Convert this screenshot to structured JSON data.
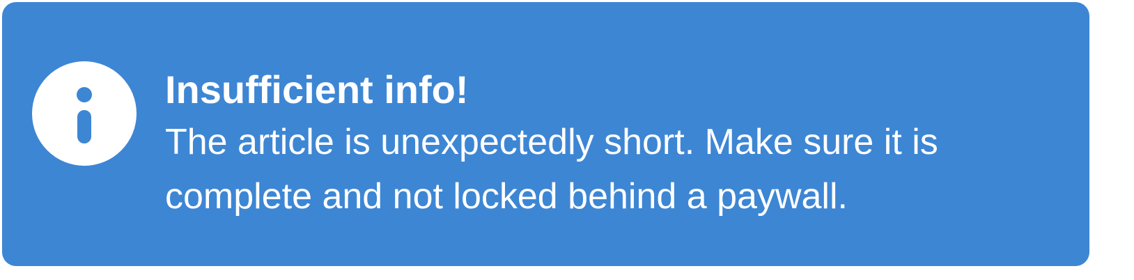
{
  "alert": {
    "type": "info",
    "icon": "info-icon",
    "background_color": "#3d86d4",
    "text_color": "#ffffff",
    "title": "Insufficient info!",
    "message": "The article is unexpectedly short. Make sure it is complete and not locked behind a paywall."
  }
}
